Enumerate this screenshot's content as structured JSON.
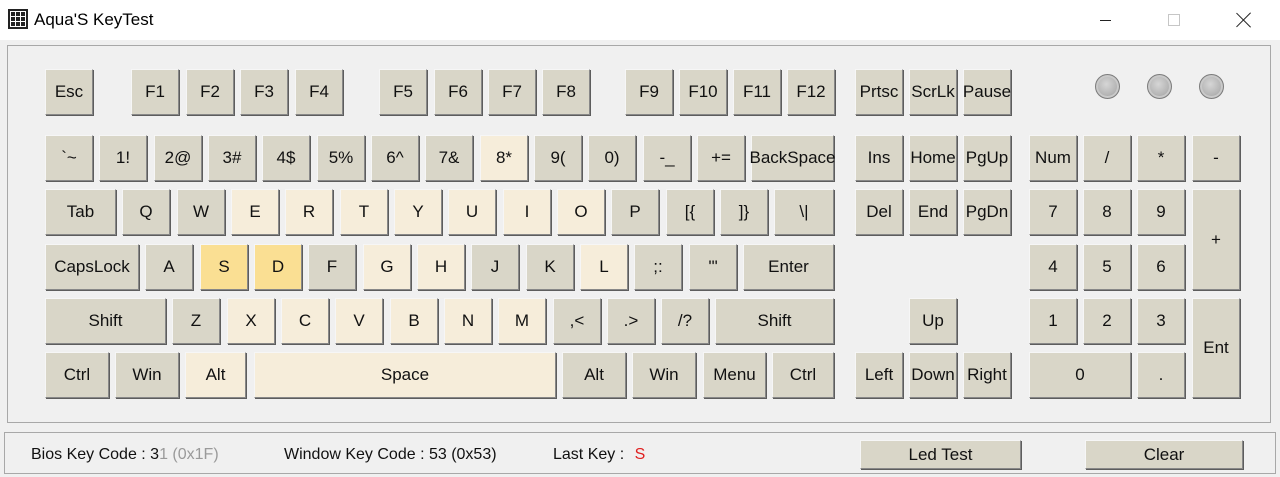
{
  "window": {
    "title": "Aqua'S KeyTest"
  },
  "keyboard": {
    "pressed_color": "#f6edda",
    "active_color": "#fadf93",
    "function_row": [
      "Esc",
      "F1",
      "F2",
      "F3",
      "F4",
      "F5",
      "F6",
      "F7",
      "F8",
      "F9",
      "F10",
      "F11",
      "F12"
    ],
    "system_keys": [
      "Prtsc",
      "ScrLk",
      "Pause"
    ],
    "number_row": [
      "`~",
      "1!",
      "2@",
      "3#",
      "4$",
      "5%",
      "6^",
      "7&",
      "8*",
      "9(",
      "0)",
      "-_",
      "+=",
      "BackSpace"
    ],
    "qwerty_row": [
      "Tab",
      "Q",
      "W",
      "E",
      "R",
      "T",
      "Y",
      "U",
      "I",
      "O",
      "P",
      "[{",
      "]}",
      "\\|"
    ],
    "home_row": [
      "CapsLock",
      "A",
      "S",
      "D",
      "F",
      "G",
      "H",
      "J",
      "K",
      "L",
      ";:",
      "'\"",
      "Enter"
    ],
    "shift_row": [
      "Shift",
      "Z",
      "X",
      "C",
      "V",
      "B",
      "N",
      "M",
      ",<",
      ".>",
      "/?",
      "Shift"
    ],
    "bottom_row": [
      "Ctrl",
      "Win",
      "Alt",
      "Space",
      "Alt",
      "Win",
      "Menu",
      "Ctrl"
    ],
    "nav_top": [
      "Ins",
      "Home",
      "PgUp"
    ],
    "nav_bottom": [
      "Del",
      "End",
      "PgDn"
    ],
    "arrows": [
      "Up",
      "Left",
      "Down",
      "Right"
    ],
    "numpad_top": [
      "Num",
      "/",
      "*",
      "-"
    ],
    "numpad_row1": [
      "7",
      "8",
      "9"
    ],
    "numpad_row2": [
      "4",
      "5",
      "6"
    ],
    "numpad_row3": [
      "1",
      "2",
      "3"
    ],
    "numpad_plus": "+",
    "numpad_enter": "Ent",
    "numpad_zero": "0",
    "numpad_dot": ".",
    "pressed_keys": [
      "8*",
      "E",
      "R",
      "T",
      "Y",
      "U",
      "I",
      "O",
      "G",
      "H",
      "L",
      "X",
      "C",
      "V",
      "B",
      "N",
      "M",
      "Alt",
      "Space"
    ],
    "active_keys": [
      "S",
      "D"
    ]
  },
  "status": {
    "bios_label": "Bios Key Code : 3",
    "bios_value_blurred": "1 (0x1F)",
    "window_label": "Window Key Code : 53 (0x53)",
    "last_key_label": "Last Key :",
    "last_key_value": "S",
    "last_key_color": "#e02020",
    "led_test_button": "Led Test",
    "clear_button": "Clear"
  }
}
